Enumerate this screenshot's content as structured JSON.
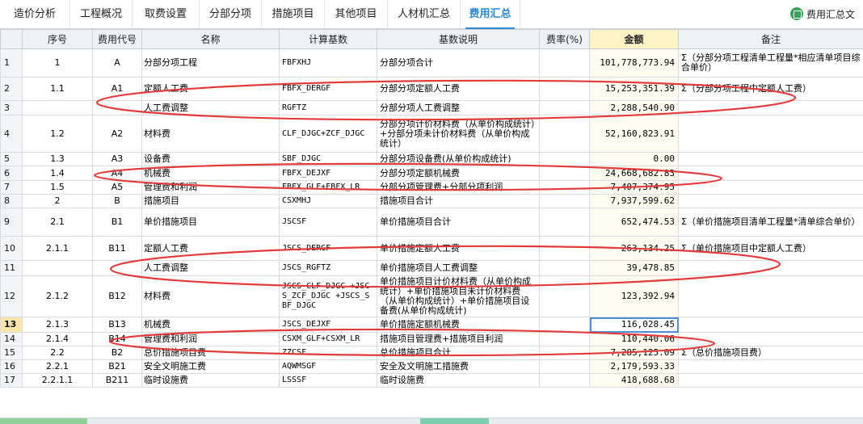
{
  "tabs": [
    {
      "label": "造价分析",
      "active": false
    },
    {
      "label": "工程概况",
      "active": false
    },
    {
      "label": "取费设置",
      "active": false
    },
    {
      "label": "分部分项",
      "active": false
    },
    {
      "label": "措施项目",
      "active": false
    },
    {
      "label": "其他项目",
      "active": false
    },
    {
      "label": "人材机汇总",
      "active": false
    },
    {
      "label": "费用汇总",
      "active": true
    }
  ],
  "toolbar": {
    "doc_button_label": "费用汇总文",
    "doc_icon": "book-icon"
  },
  "colors": {
    "accent": "#2d8ad8",
    "annotation_red": "#e23b3b",
    "amount_header": "#fdf3c5"
  },
  "table": {
    "headers": {
      "rownum": "",
      "seq": "序号",
      "code": "费用代号",
      "name": "名称",
      "base": "计算基数",
      "base_desc": "基数说明",
      "rate": "费率(%)",
      "amount": "金额",
      "remark": "备注"
    },
    "selected_row": "13",
    "rows": [
      {
        "n": "1",
        "seq": "1",
        "code": "A",
        "name": "分部分项工程",
        "base": "FBFXHJ",
        "desc": "分部分项合计",
        "rate": "",
        "amount": "101,778,773.94",
        "remark": "Σ（分部分项工程清单工程量*相应清单项目综合单价）"
      },
      {
        "n": "2",
        "seq": "1.1",
        "code": "A1",
        "name": "定额人工费",
        "base": "FBFX_DERGF",
        "desc": "分部分项定额人工费",
        "rate": "",
        "amount": "15,253,351.39",
        "remark": "Σ（分部分项工程中定额人工费）"
      },
      {
        "n": "3",
        "seq": "",
        "code": "",
        "name": "人工费调整",
        "base": "RGFTZ",
        "desc": "分部分项人工费调整",
        "rate": "",
        "amount": "2,288,540.90",
        "remark": ""
      },
      {
        "n": "4",
        "seq": "1.2",
        "code": "A2",
        "name": "材料费",
        "base": "CLF_DJGC+ZCF_DJGC",
        "desc": "分部分项计价材料费（从单价构成统计）+分部分项未计价材料费（从单价构成统计）",
        "rate": "",
        "amount": "52,160,823.91",
        "remark": ""
      },
      {
        "n": "5",
        "seq": "1.3",
        "code": "A3",
        "name": "设备费",
        "base": "SBF_DJGC",
        "desc": "分部分项设备费(从单价构成统计)",
        "rate": "",
        "amount": "0.00",
        "remark": ""
      },
      {
        "n": "6",
        "seq": "1.4",
        "code": "A4",
        "name": "机械费",
        "base": "FBFX_DEJXF",
        "desc": "分部分项定额机械费",
        "rate": "",
        "amount": "24,668,682.83",
        "remark": ""
      },
      {
        "n": "7",
        "seq": "1.5",
        "code": "A5",
        "name": "管理费和利润",
        "base": "FBFX_GLF+FBFX_LR",
        "desc": "分部分项管理费+分部分项利润",
        "rate": "",
        "amount": "7,407,374.95",
        "remark": ""
      },
      {
        "n": "8",
        "seq": "2",
        "code": "B",
        "name": "措施项目",
        "base": "CSXMHJ",
        "desc": "措施项目合计",
        "rate": "",
        "amount": "7,937,599.62",
        "remark": ""
      },
      {
        "n": "9",
        "seq": "2.1",
        "code": "B1",
        "name": "单价措施项目",
        "base": "JSCSF",
        "desc": "单价措施项目合计",
        "rate": "",
        "amount": "652,474.53",
        "remark": "Σ（单价措施项目清单工程量*清单综合单价）"
      },
      {
        "n": "10",
        "seq": "2.1.1",
        "code": "B11",
        "name": "定额人工费",
        "base": "JSCS_DERGF",
        "desc": "单价措施定额人工费",
        "rate": "",
        "amount": "263,134.25",
        "remark": "Σ（单价措施项目中定额人工费）"
      },
      {
        "n": "11",
        "seq": "",
        "code": "",
        "name": "人工费调整",
        "base": "JSCS_RGFTZ",
        "desc": "单价措施项目人工费调整",
        "rate": "",
        "amount": "39,478.85",
        "remark": ""
      },
      {
        "n": "12",
        "seq": "2.1.2",
        "code": "B12",
        "name": "材料费",
        "base": "JSCS_CLF_DJGC +JSCS_ZCF_DJGC +JSCS_SBF_DJGC",
        "desc": "单价措施项目计价材料费（从单价构成统计）+单价措施项目未计价材料费（从单价构成统计）+单价措施项目设备费(从单价构成统计)",
        "rate": "",
        "amount": "123,392.94",
        "remark": ""
      },
      {
        "n": "13",
        "seq": "2.1.3",
        "code": "B13",
        "name": "机械费",
        "base": "JSCS_DEJXF",
        "desc": "单价措施定额机械费",
        "rate": "",
        "amount": "116,028.45",
        "remark": ""
      },
      {
        "n": "14",
        "seq": "2.1.4",
        "code": "B14",
        "name": "管理费和利润",
        "base": "CSXM_GLF+CSXM_LR",
        "desc": "措施项目管理费+措施项目利润",
        "rate": "",
        "amount": "110,440.06",
        "remark": ""
      },
      {
        "n": "15",
        "seq": "2.2",
        "code": "B2",
        "name": "总价措施项目费",
        "base": "ZZCSF",
        "desc": "总价措施项目合计",
        "rate": "",
        "amount": "7,285,125.09",
        "remark": "Σ（总价措施项目费）"
      },
      {
        "n": "16",
        "seq": "2.2.1",
        "code": "B21",
        "name": "安全文明施工费",
        "base": "AQWMSGF",
        "desc": "安全及文明施工措施费",
        "rate": "",
        "amount": "2,179,593.33",
        "remark": ""
      },
      {
        "n": "17",
        "seq": "2.2.1.1",
        "code": "B211",
        "name": "临时设施费",
        "base": "LSSSF",
        "desc": "临时设施费",
        "rate": "",
        "amount": "418,688.68",
        "remark": ""
      }
    ]
  }
}
